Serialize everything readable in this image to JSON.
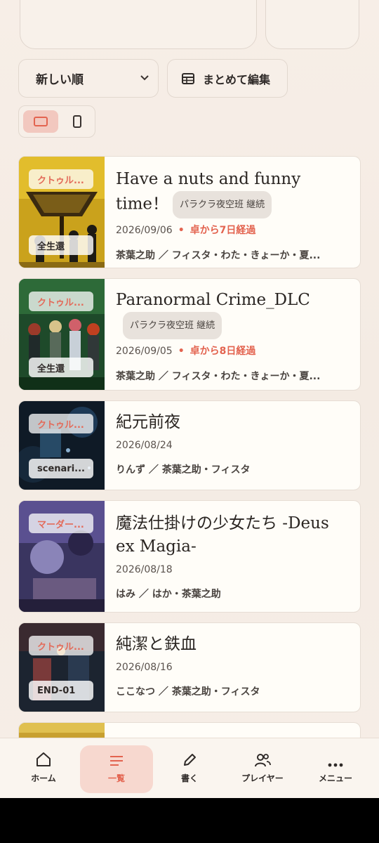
{
  "toolbar": {
    "sort_value": "新しい順",
    "bulk_edit_label": "まとめて編集"
  },
  "colors": {
    "accent": "#e3634f",
    "card_bg": "#fffdf8",
    "page_bg": "#f7eee7"
  },
  "cards": [
    {
      "title": "Have a nuts and funny time！",
      "group": "パラクラ夜空班 継続",
      "date": "2026/09/06",
      "elapsed": "卓から7日経過",
      "players": "茶葉之助 ／ フィスタ・わた・きょーか・夏...",
      "genre": "クトゥル...",
      "status": "全生還"
    },
    {
      "title": "Paranormal Crime_DLC",
      "group": "パラクラ夜空班 継続",
      "date": "2026/09/05",
      "elapsed": "卓から8日経過",
      "players": "茶葉之助 ／ フィスタ・わた・きょーか・夏...",
      "genre": "クトゥル...",
      "status": "全生還"
    },
    {
      "title": "紀元前夜",
      "date": "2026/08/24",
      "players": "りんず ／ 茶葉之助・フィスタ",
      "genre": "クトゥル...",
      "status": "scenari..."
    },
    {
      "title": "魔法仕掛けの少女たち -Deus ex Magia-",
      "date": "2026/08/18",
      "players": "はみ ／ はか・茶葉之助",
      "genre": "マーダー..."
    },
    {
      "title": "純潔と鉄血",
      "date": "2026/08/16",
      "players": "ここなつ ／ 茶葉之助・フィスタ",
      "genre": "クトゥル...",
      "status": "END-01"
    }
  ],
  "nav": [
    {
      "label": "ホーム",
      "icon": "home-icon"
    },
    {
      "label": "一覧",
      "icon": "list-icon",
      "active": true
    },
    {
      "label": "書く",
      "icon": "pencil-icon"
    },
    {
      "label": "プレイヤー",
      "icon": "users-icon"
    },
    {
      "label": "メニュー",
      "icon": "more-icon"
    }
  ]
}
